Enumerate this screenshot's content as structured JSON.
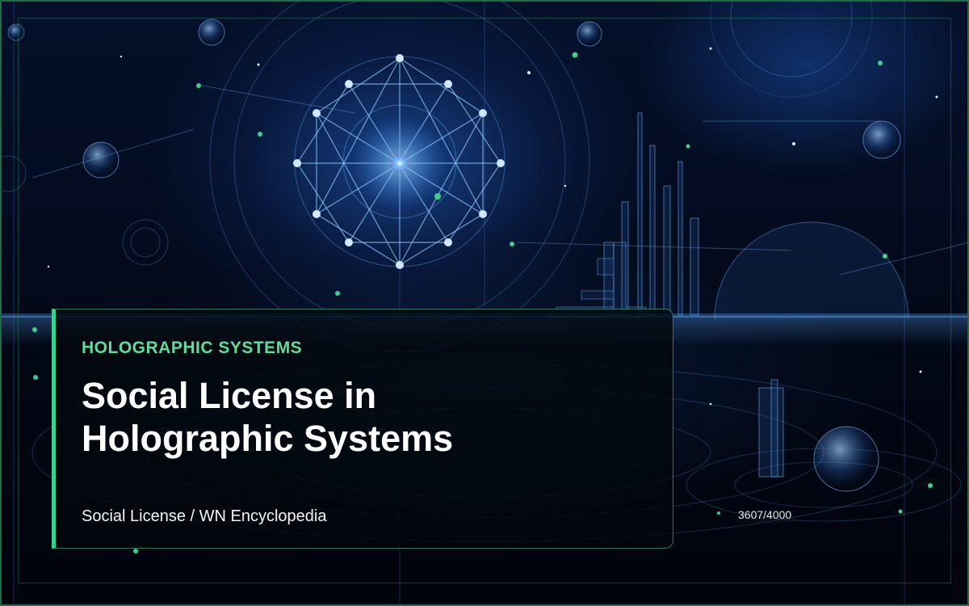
{
  "card": {
    "category": "HOLOGRAPHIC SYSTEMS",
    "title_line1": "Social License in",
    "title_line2": "Holographic Systems",
    "source": "Social License / WN Encyclopedia"
  },
  "counter": "3607/4000",
  "colors": {
    "accent": "#3ccf8e",
    "category_text": "#5fdc9e",
    "frame_border": "#1e6b47",
    "background": "#020510"
  },
  "background": {
    "description_icon": "holographic-geometry-illustration"
  }
}
